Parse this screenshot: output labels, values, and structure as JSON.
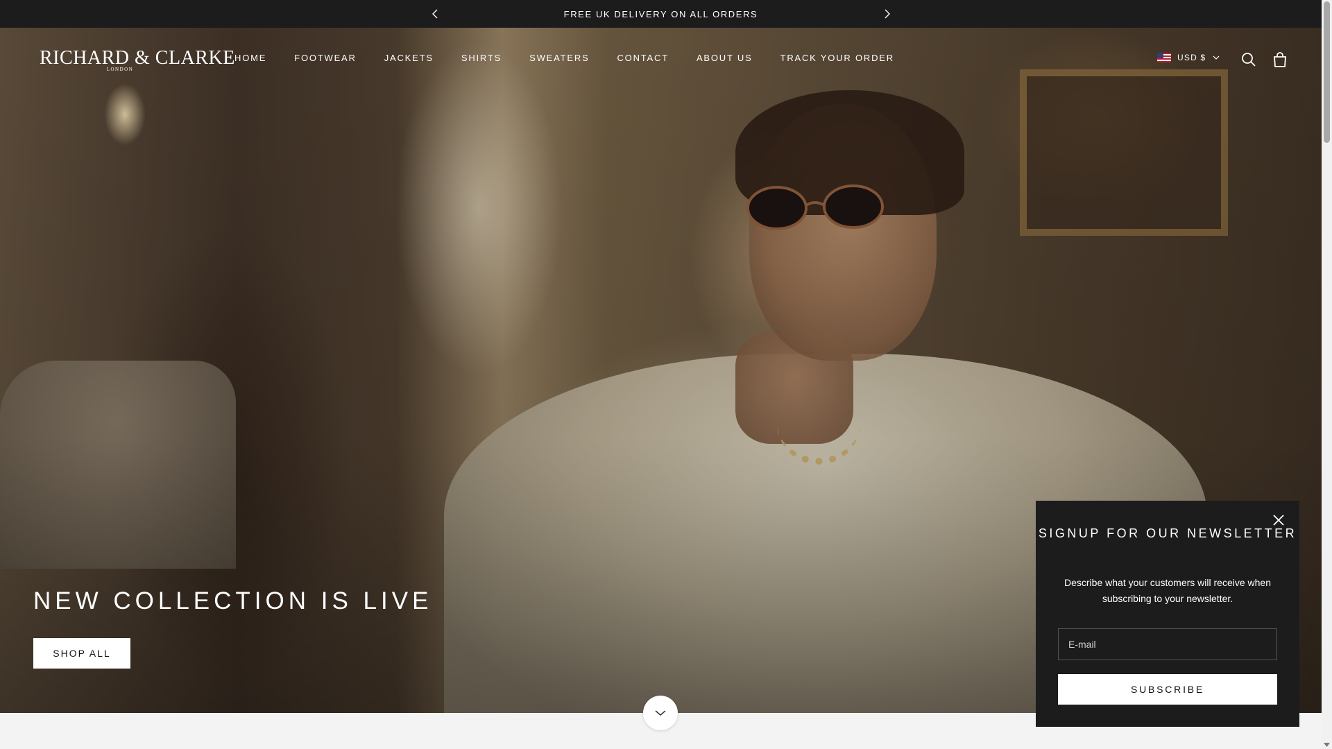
{
  "announcement": {
    "text": "FREE UK DELIVERY ON ALL ORDERS",
    "prev_icon": "chevron-left-icon",
    "next_icon": "chevron-right-icon"
  },
  "brand": {
    "logo_name": "RICHARD & CLARKE",
    "logo_sub": "LONDON"
  },
  "nav": {
    "items": [
      "HOME",
      "FOOTWEAR",
      "JACKETS",
      "SHIRTS",
      "SWEATERS",
      "CONTACT",
      "ABOUT US",
      "TRACK YOUR ORDER"
    ]
  },
  "header_actions": {
    "currency": "USD $",
    "currency_flag": "us-flag-icon",
    "search_icon": "search-icon",
    "cart_icon": "shopping-bag-icon"
  },
  "hero": {
    "title": "NEW COLLECTION IS LIVE",
    "button_label": "SHOP ALL",
    "scroll_icon": "chevron-down-icon"
  },
  "newsletter": {
    "title": "SIGNUP FOR OUR NEWSLETTER",
    "description": "Describe what your customers will receive when subscribing to your newsletter.",
    "email_placeholder": "E-mail",
    "button_label": "SUBSCRIBE",
    "close_icon": "close-icon"
  },
  "colors": {
    "announcement_bg": "#1c1c1c",
    "popup_bg": "#1c1c1c",
    "button_bg": "#ffffff",
    "page_bg": "#f3f3f3"
  }
}
